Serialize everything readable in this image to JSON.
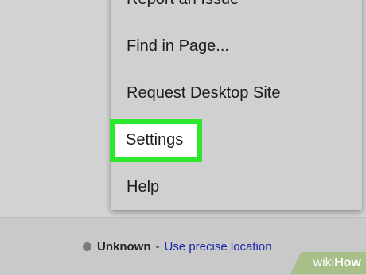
{
  "menu": {
    "items": [
      {
        "label": "Report an Issue"
      },
      {
        "label": "Find in Page..."
      },
      {
        "label": "Request Desktop Site"
      },
      {
        "label": "Settings"
      },
      {
        "label": "Help"
      }
    ]
  },
  "footer": {
    "location_status": "Unknown",
    "separator": "-",
    "location_link": "Use precise location"
  },
  "watermark": {
    "wiki": "wiki",
    "how": "How"
  },
  "colors": {
    "highlight_border": "#2ce82c",
    "link": "#1a27a8"
  }
}
